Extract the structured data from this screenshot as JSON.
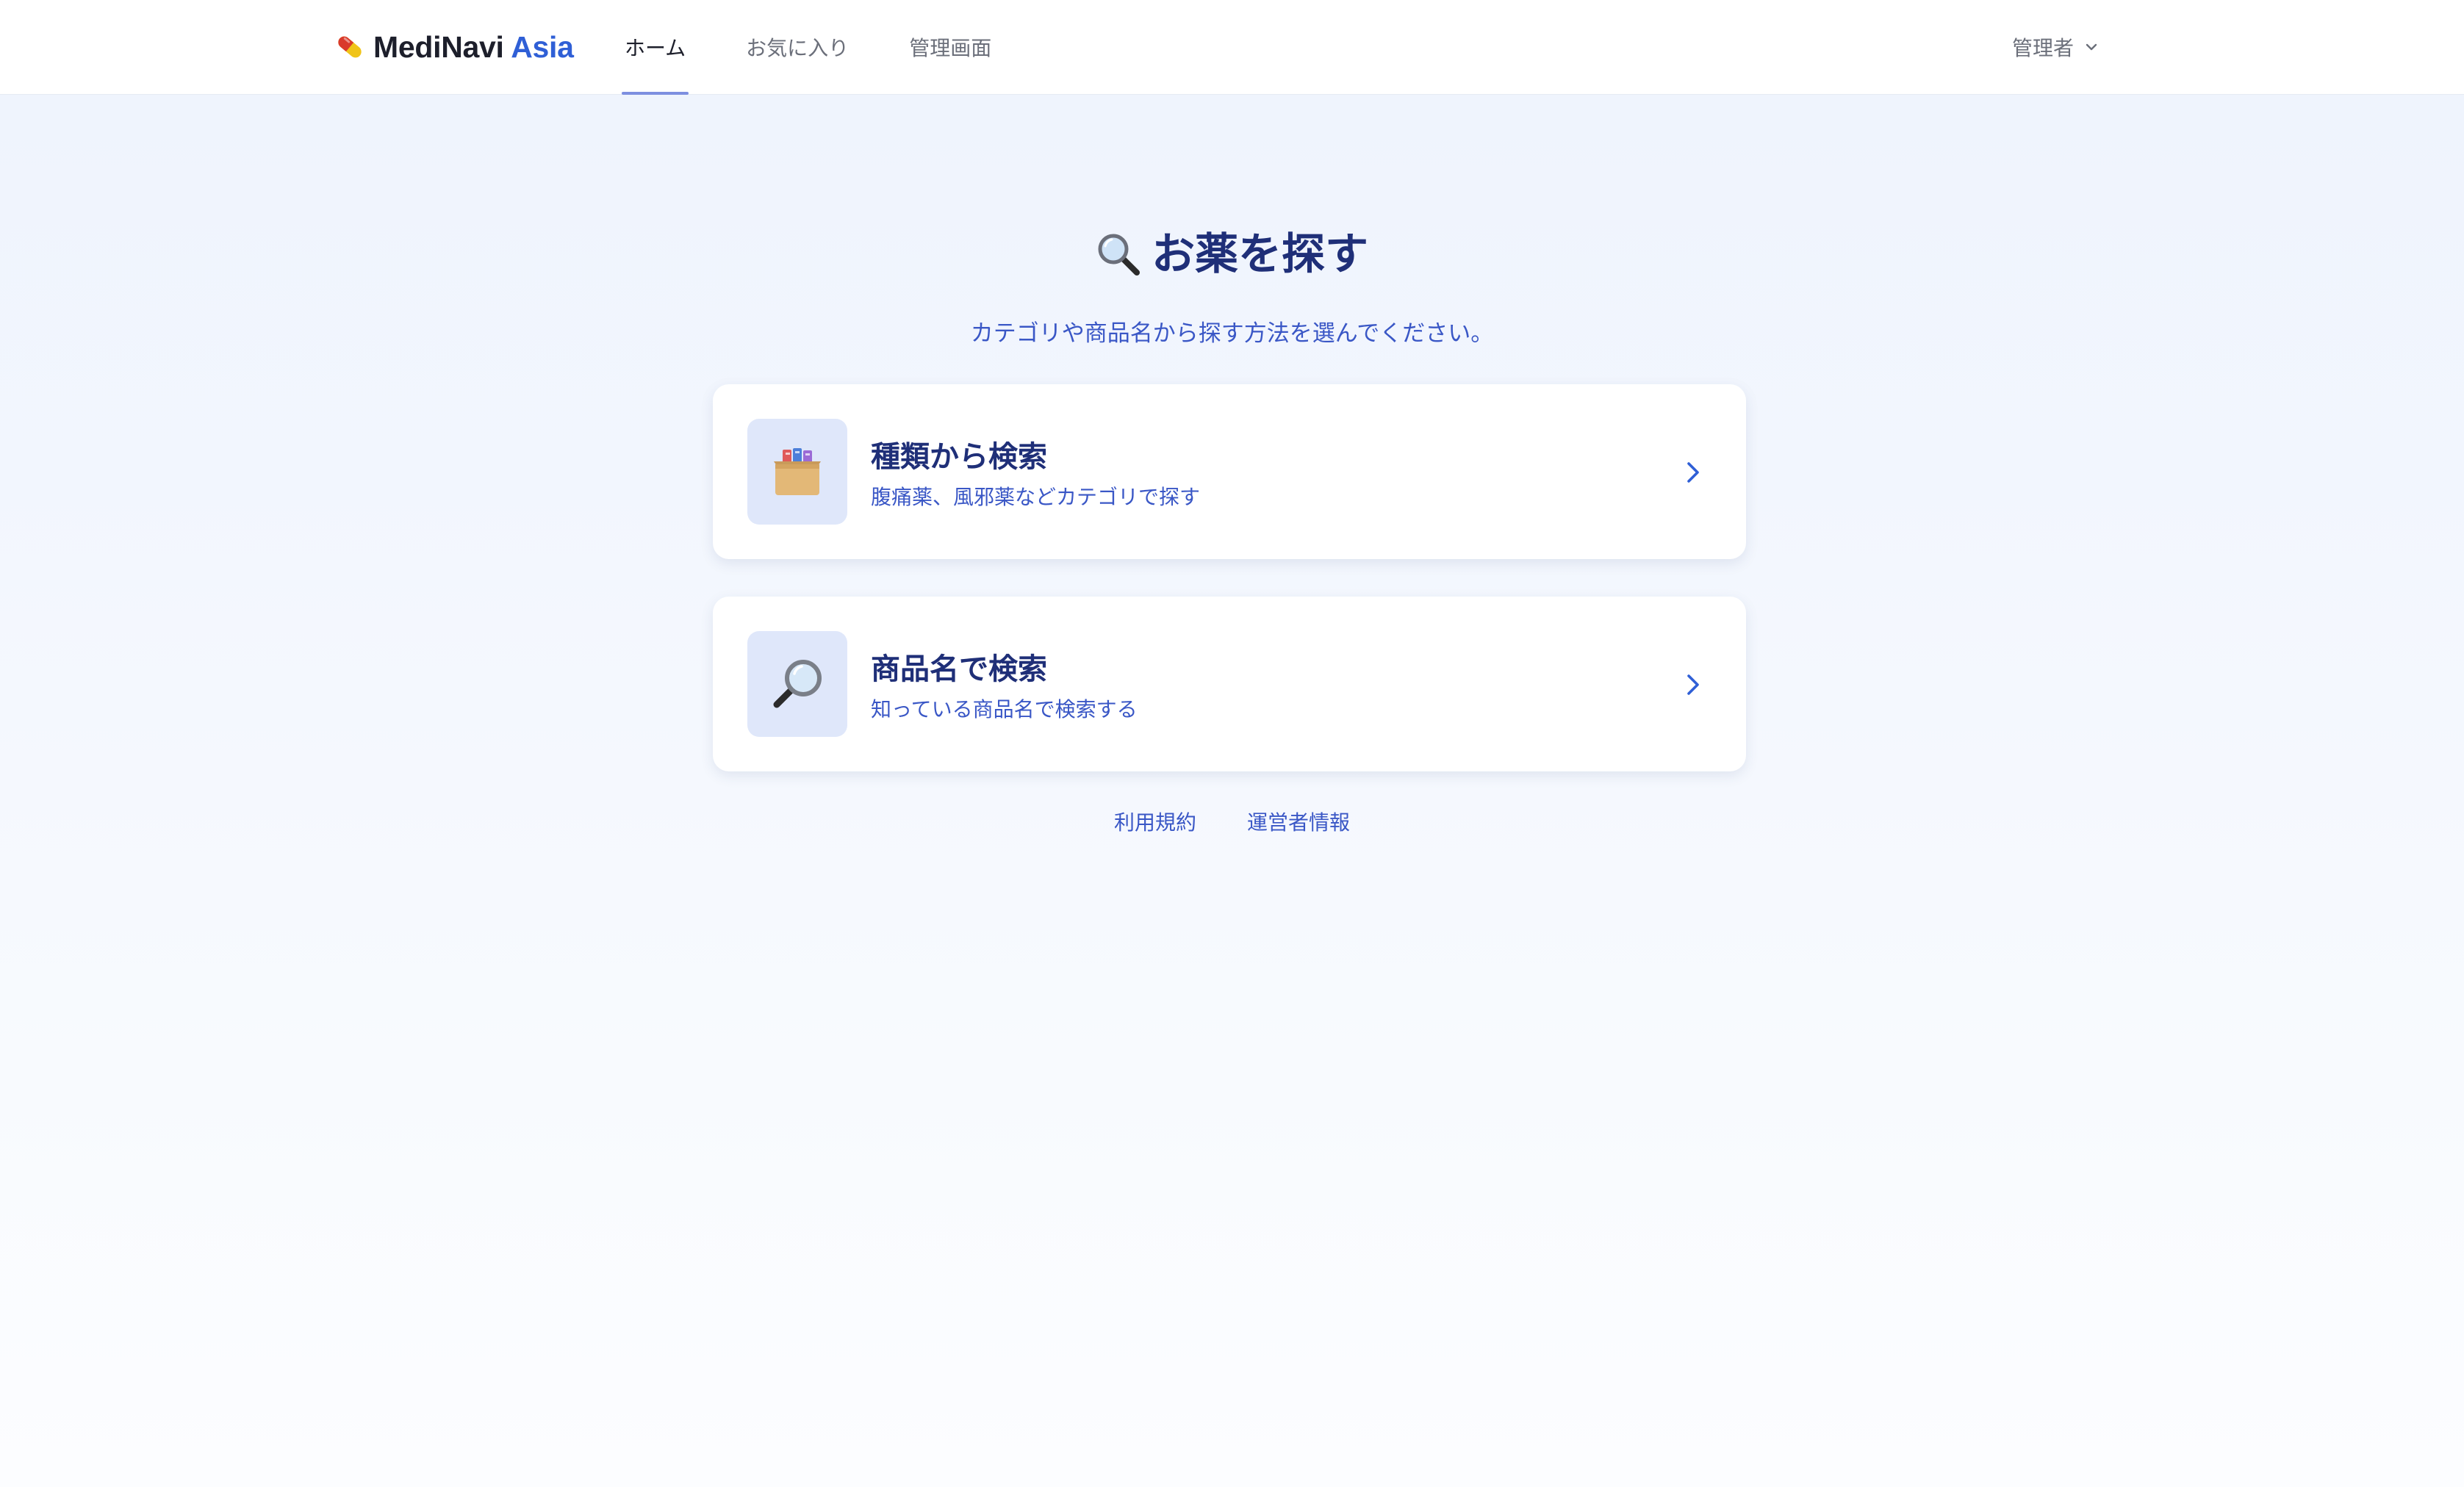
{
  "header": {
    "logo_main": "MediNavi",
    "logo_accent": "Asia",
    "nav": [
      {
        "label": "ホーム",
        "active": true
      },
      {
        "label": "お気に入り",
        "active": false
      },
      {
        "label": "管理画面",
        "active": false
      }
    ],
    "user_label": "管理者"
  },
  "main": {
    "title": "お薬を探す",
    "subtitle": "カテゴリや商品名から探す方法を選んでください。",
    "cards": [
      {
        "title": "種類から検索",
        "description": "腹痛薬、風邪薬などカテゴリで探す",
        "icon": "card-file-box-icon"
      },
      {
        "title": "商品名で検索",
        "description": "知っている商品名で検索する",
        "icon": "magnifying-glass-icon"
      }
    ]
  },
  "footer": {
    "links": [
      "利用規約",
      "運営者情報"
    ]
  },
  "colors": {
    "primary_dark": "#1f2f78",
    "primary": "#3a57c6",
    "accent_logo": "#2f5fd6",
    "icon_bg": "#dfe7fa"
  }
}
